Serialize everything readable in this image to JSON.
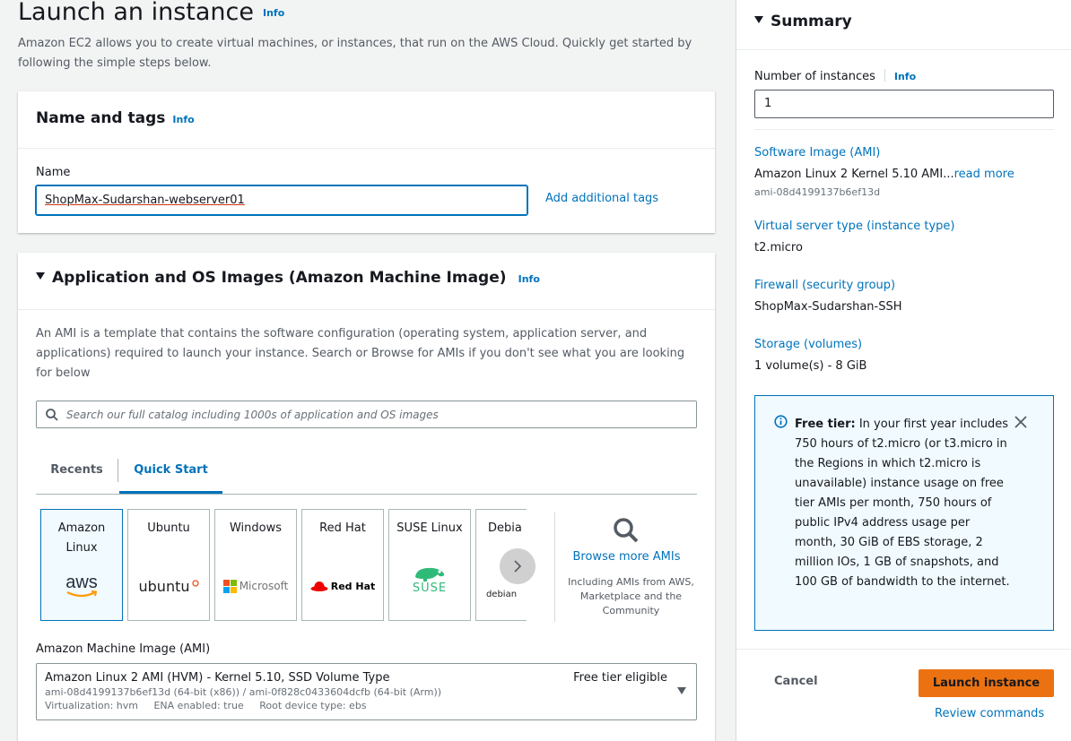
{
  "page": {
    "title": "Launch an instance",
    "info": "Info",
    "description": "Amazon EC2 allows you to create virtual machines, or instances, that run on the AWS Cloud. Quickly get started by following the simple steps below."
  },
  "name_tags": {
    "title": "Name and tags",
    "info": "Info",
    "name_label": "Name",
    "name_value": "ShopMax-Sudarshan-webserver01",
    "add_tags": "Add additional tags"
  },
  "ami_section": {
    "title": "Application and OS Images (Amazon Machine Image)",
    "info": "Info",
    "description": "An AMI is a template that contains the software configuration (operating system, application server, and applications) required to launch your instance. Search or Browse for AMIs if you don't see what you are looking for below",
    "search_placeholder": "Search our full catalog including 1000s of application and OS images",
    "tabs": [
      "Recents",
      "Quick Start"
    ],
    "active_tab": "Quick Start",
    "os_tiles": [
      {
        "name": "Amazon Linux",
        "logo": "aws",
        "selected": true
      },
      {
        "name": "Ubuntu",
        "logo": "ubuntu"
      },
      {
        "name": "Windows",
        "logo": "Microsoft"
      },
      {
        "name": "Red Hat",
        "logo": "Red Hat"
      },
      {
        "name": "SUSE Linux",
        "logo": "SUSE"
      },
      {
        "name": "Debia",
        "logo": "debian"
      }
    ],
    "browse_more": "Browse more AMIs",
    "browse_sub": "Including AMIs from AWS, Marketplace and the Community",
    "ami_label": "Amazon Machine Image (AMI)",
    "ami_selected": {
      "name": "Amazon Linux 2 AMI (HVM) - Kernel 5.10, SSD Volume Type",
      "ids": "ami-08d4199137b6ef13d (64-bit (x86)) / ami-0f828c0433604dcfb (64-bit (Arm))",
      "virtualization": "Virtualization: hvm",
      "ena": "ENA enabled: true",
      "root": "Root device type: ebs",
      "free_tier": "Free tier eligible"
    }
  },
  "summary": {
    "title": "Summary",
    "instances_label": "Number of instances",
    "info": "Info",
    "instances_value": "1",
    "software_image_label": "Software Image (AMI)",
    "software_image_value": "Amazon Linux 2 Kernel 5.10 AMI...",
    "read_more": "read more",
    "software_image_id": "ami-08d4199137b6ef13d",
    "instance_type_label": "Virtual server type (instance type)",
    "instance_type_value": "t2.micro",
    "firewall_label": "Firewall (security group)",
    "firewall_value": "ShopMax-Sudarshan-SSH",
    "storage_label": "Storage (volumes)",
    "storage_value": "1 volume(s) - 8 GiB",
    "free_tier_bold": "Free tier:",
    "free_tier_text": " In your first year includes 750 hours of t2.micro (or t3.micro in the Regions in which t2.micro is unavailable) instance usage on free tier AMIs per month, 750 hours of public IPv4 address usage per month, 30 GiB of EBS storage, 2 million IOs, 1 GB of snapshots, and 100 GB of bandwidth to the internet.",
    "cancel": "Cancel",
    "launch": "Launch instance",
    "review": "Review commands"
  },
  "colors": {
    "link": "#0073bb",
    "primary_button": "#ec7211",
    "panel_bg": "#ffffff",
    "page_bg": "#f2f3f3"
  }
}
